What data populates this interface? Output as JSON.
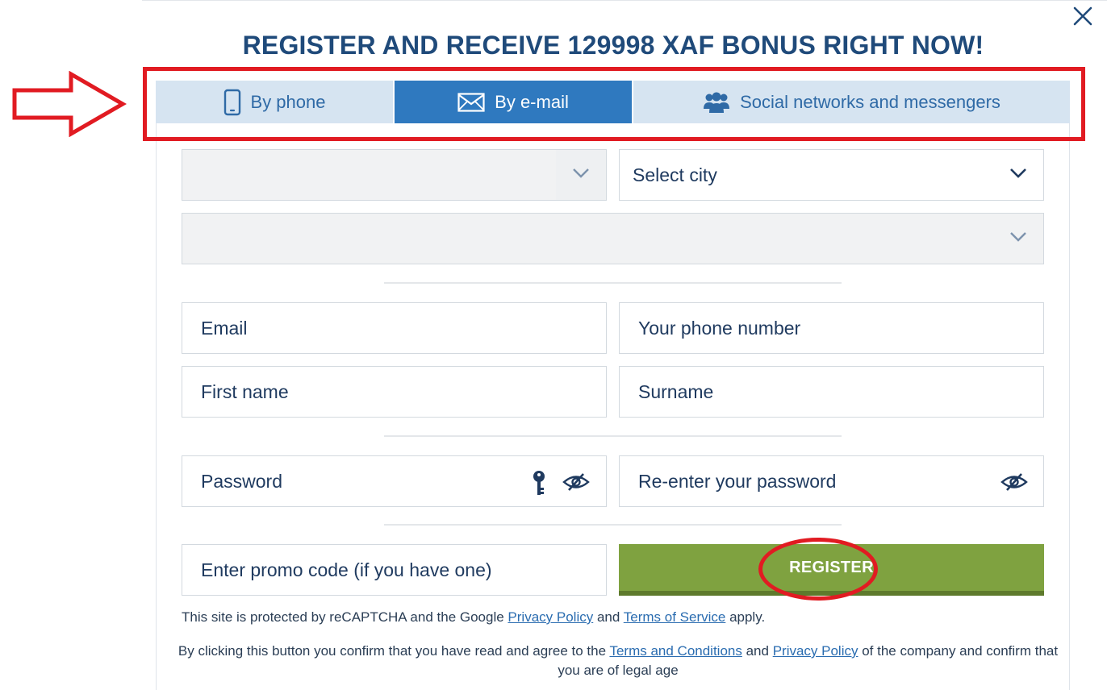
{
  "header": {
    "title": "REGISTER AND RECEIVE 129998 XAF BONUS RIGHT NOW!"
  },
  "tabs": [
    {
      "label": "By phone",
      "icon": "smartphone-icon",
      "active": false
    },
    {
      "label": "By e-mail",
      "icon": "envelope-icon",
      "active": true
    },
    {
      "label": "Social networks and messengers",
      "icon": "people-icon",
      "active": false
    }
  ],
  "form": {
    "country_select": {
      "value": ""
    },
    "city_select": {
      "value": "Select city"
    },
    "currency_select": {
      "value": ""
    },
    "email": {
      "placeholder": "Email"
    },
    "phone": {
      "placeholder": "Your phone number"
    },
    "first_name": {
      "placeholder": "First name"
    },
    "surname": {
      "placeholder": "Surname"
    },
    "password": {
      "placeholder": "Password"
    },
    "password_repeat": {
      "placeholder": "Re-enter your password"
    },
    "promo": {
      "placeholder": "Enter promo code (if you have one)"
    },
    "register_label": "REGISTER"
  },
  "notes": {
    "recaptcha_prefix": "This site is protected by reCAPTCHA and the Google ",
    "privacy_policy": "Privacy Policy",
    "and": " and ",
    "terms_of_service": "Terms of Service",
    "recaptcha_suffix": " apply.",
    "confirm_prefix": "By clicking this button you confirm that you have read and agree to the ",
    "terms_and_conditions": "Terms and Conditions",
    "and2": " and ",
    "privacy_policy2": "Privacy Policy",
    "confirm_suffix": " of the company and confirm that you are of legal age"
  },
  "colors": {
    "accent": "#2f79bf",
    "tab_inactive": "#d6e4f1",
    "register_green": "#7fa240",
    "annotation_red": "#e11b22",
    "title": "#1f4a7a"
  }
}
